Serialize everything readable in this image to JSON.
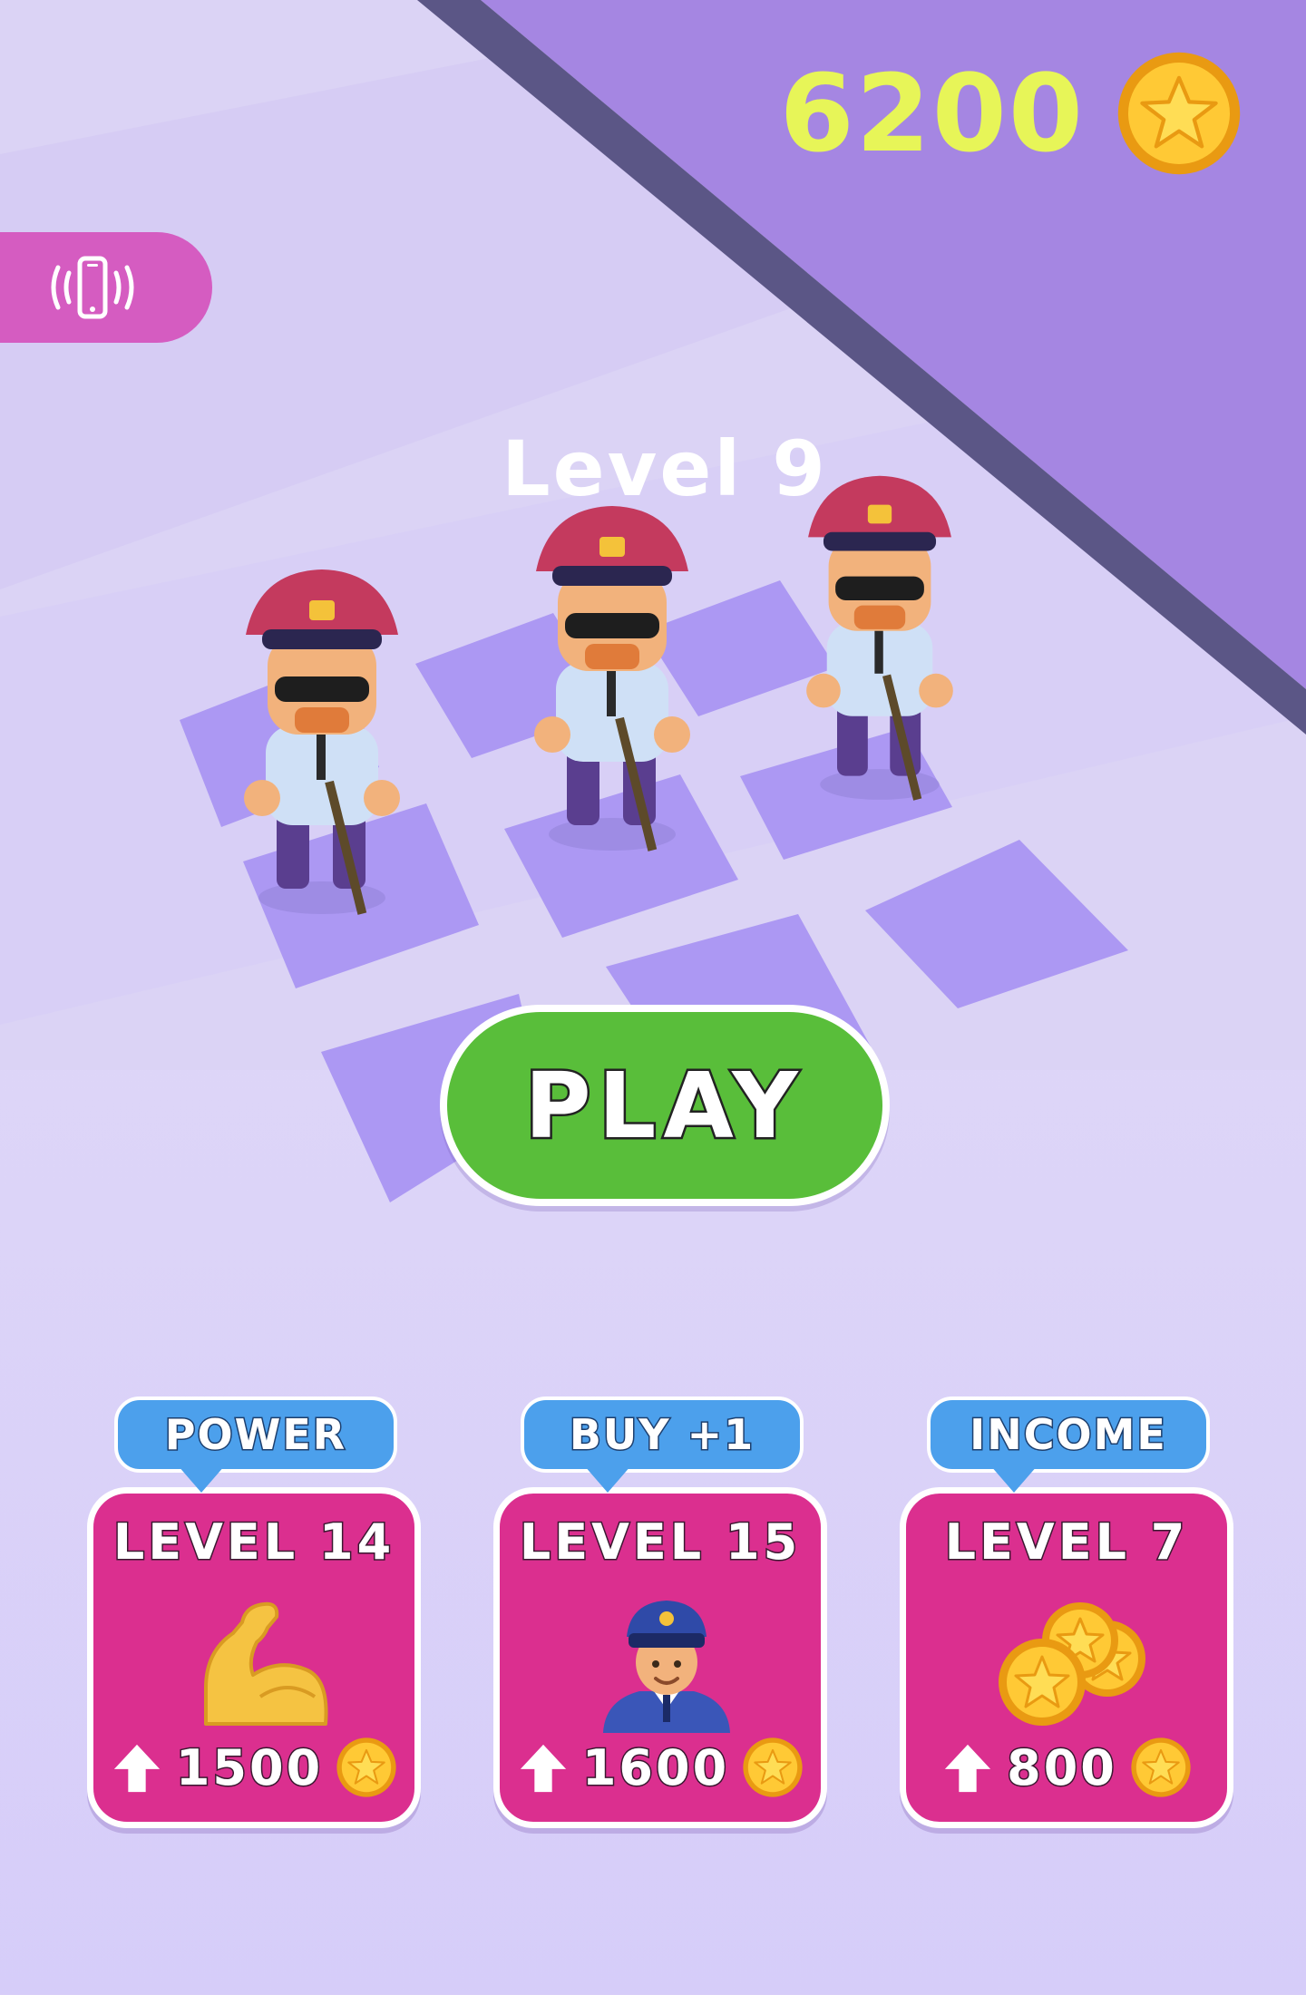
{
  "currency": {
    "coins": "6200",
    "coin_icon": "star-coin-icon"
  },
  "header": {
    "vibration_toggle_icon": "vibrate-phone-icon"
  },
  "level": {
    "title": "Level 9"
  },
  "play_button": {
    "label": "PLAY"
  },
  "upgrades": [
    {
      "tag": "POWER",
      "level": "LEVEL 14",
      "icon": "flexed-biceps-icon",
      "cost": "1500"
    },
    {
      "tag": "BUY +1",
      "level": "LEVEL 15",
      "icon": "police-officer-icon",
      "cost": "1600"
    },
    {
      "tag": "INCOME",
      "level": "LEVEL 7",
      "icon": "coin-stack-icon",
      "cost": "800"
    }
  ],
  "colors": {
    "coin_text": "#e7f558",
    "play_green": "#59be3a",
    "card_pink": "#db2f8f",
    "tag_blue": "#4ca0ec",
    "vibrate_pink": "#d55cc1"
  }
}
